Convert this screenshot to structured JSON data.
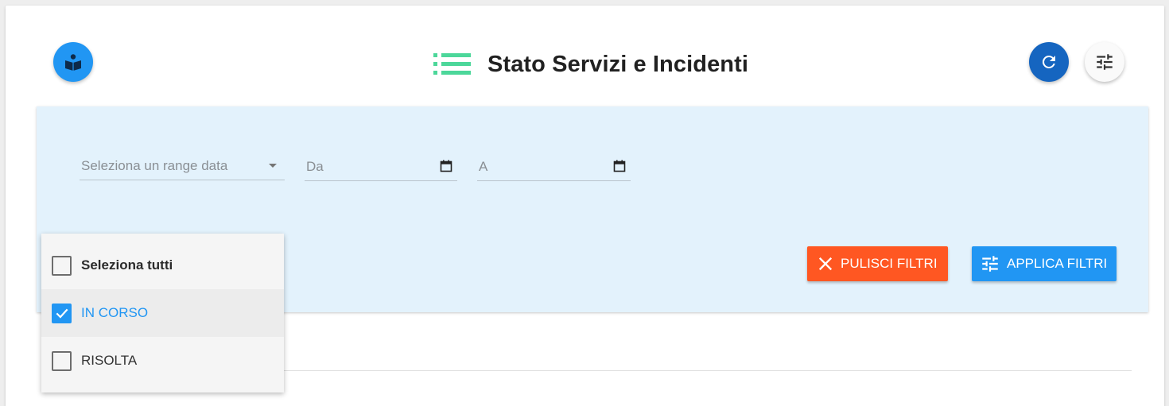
{
  "header": {
    "title": "Stato Servizi e Incidenti"
  },
  "filters": {
    "range_placeholder": "Seleziona un range data",
    "from_label": "Da",
    "to_label": "A",
    "clear_label": "PULISCI FILTRI",
    "apply_label": "APPLICA FILTRI"
  },
  "status_dropdown": {
    "options": [
      {
        "label": "Seleziona tutti",
        "checked": false
      },
      {
        "label": "IN CORSO",
        "checked": true
      },
      {
        "label": "RISOLTA",
        "checked": false
      }
    ]
  },
  "colors": {
    "primary": "#2196f3",
    "primary_dark": "#1565c0",
    "danger": "#ff5722",
    "title_icon": "#4cd79a",
    "panel_bg": "#e3f2fc"
  },
  "icons": {
    "help": "book-reader-icon",
    "title": "list-icon",
    "refresh": "refresh-icon",
    "settings": "tune-icon",
    "clear": "close-icon",
    "apply": "tune-icon",
    "calendar": "calendar-icon",
    "dropdown": "caret-down-icon",
    "check": "check-icon"
  }
}
